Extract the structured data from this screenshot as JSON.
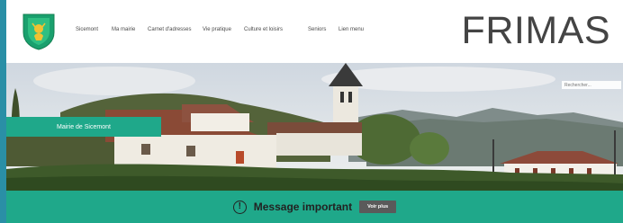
{
  "header": {
    "brand": "FRIMAS",
    "nav": [
      {
        "label": "Sicemont",
        "name": "nav-item-sicemont"
      },
      {
        "label": "Ma mairie",
        "name": "nav-item-ma-mairie"
      },
      {
        "label": "Carnet d'adresses",
        "name": "nav-item-carnet-adresses"
      },
      {
        "label": "Vie pratique",
        "name": "nav-item-vie-pratique"
      },
      {
        "label": "Culture et loisirs",
        "name": "nav-item-culture-loisirs"
      },
      {
        "label": "Seniors",
        "name": "nav-item-seniors"
      },
      {
        "label": "Lien menu",
        "name": "nav-item-lien-menu"
      }
    ]
  },
  "search": {
    "placeholder": "Rechercher..."
  },
  "hero": {
    "tag_label": "Mairie de Sicemont"
  },
  "banner": {
    "message": "Message important",
    "button_label": "Voir plus",
    "icon": "alert-circle-icon"
  },
  "colors": {
    "accent": "#1fa88a",
    "frame": "#2a8fa6",
    "button": "#5a5a5a",
    "text": "#444444"
  }
}
